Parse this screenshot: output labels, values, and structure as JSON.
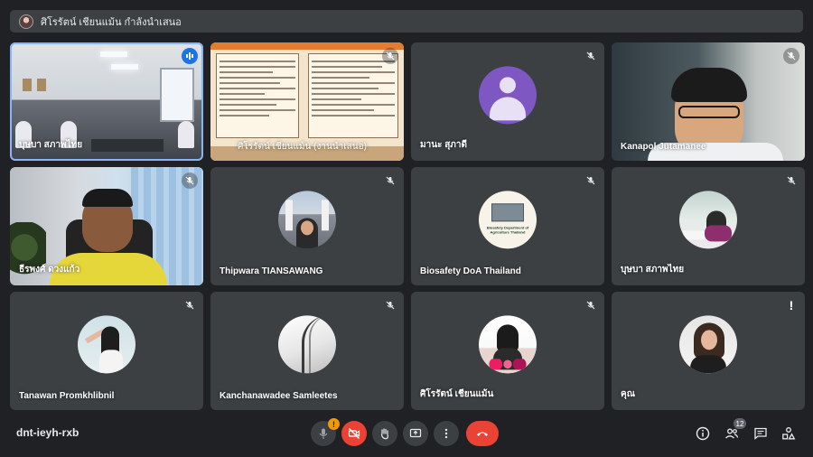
{
  "presenting": {
    "text": "ศิโรรัตน์ เชียนแม้น กำลังนำเสนอ"
  },
  "tiles": [
    {
      "name": "บุษบา สภาพไทย",
      "mic": "speaking"
    },
    {
      "name": "ศิโรรัตน์ เชียนแม้น (งานนำเสนอ)",
      "mic": "muted"
    },
    {
      "name": "มานะ สุภาดี",
      "mic": "muted"
    },
    {
      "name": "Kanapol Jutamanee",
      "mic": "muted"
    },
    {
      "name": "ธีรพงศ์ ดวงแก้ว",
      "mic": "muted"
    },
    {
      "name": "Thipwara TIANSAWANG",
      "mic": "muted"
    },
    {
      "name": "Biosafety DoA Thailand",
      "mic": "muted",
      "avatar_text": "Biosafety Department of Agriculture Thailand"
    },
    {
      "name": "บุษบา สภาพไทย",
      "mic": "muted"
    },
    {
      "name": "Tanawan Promkhlibnil",
      "mic": "muted"
    },
    {
      "name": "Kanchanawadee Samleetes",
      "mic": "muted"
    },
    {
      "name": "ศิโรรัตน์ เชียนแม้น",
      "mic": "muted"
    },
    {
      "name": "คุณ",
      "mic": "alert",
      "alert_glyph": "!"
    }
  ],
  "bottombar": {
    "meeting_code": "dnt-ieyh-rxb",
    "mic_badge": "!",
    "participants_count": "12"
  },
  "icons": {
    "mic_muted": "mic-off-icon",
    "mic_speaking": "audio-bars-icon",
    "camera_off": "camera-off-icon",
    "raise_hand": "hand-icon",
    "present": "present-screen-icon",
    "more": "more-vert-icon",
    "hangup": "call-end-icon",
    "info": "info-icon",
    "people": "people-icon",
    "chat": "chat-icon",
    "activities": "activities-icon"
  },
  "colors": {
    "background": "#202124",
    "tile": "#3c4043",
    "active_outline": "#8ab4f8",
    "danger": "#ea4335",
    "warning": "#f29900"
  }
}
